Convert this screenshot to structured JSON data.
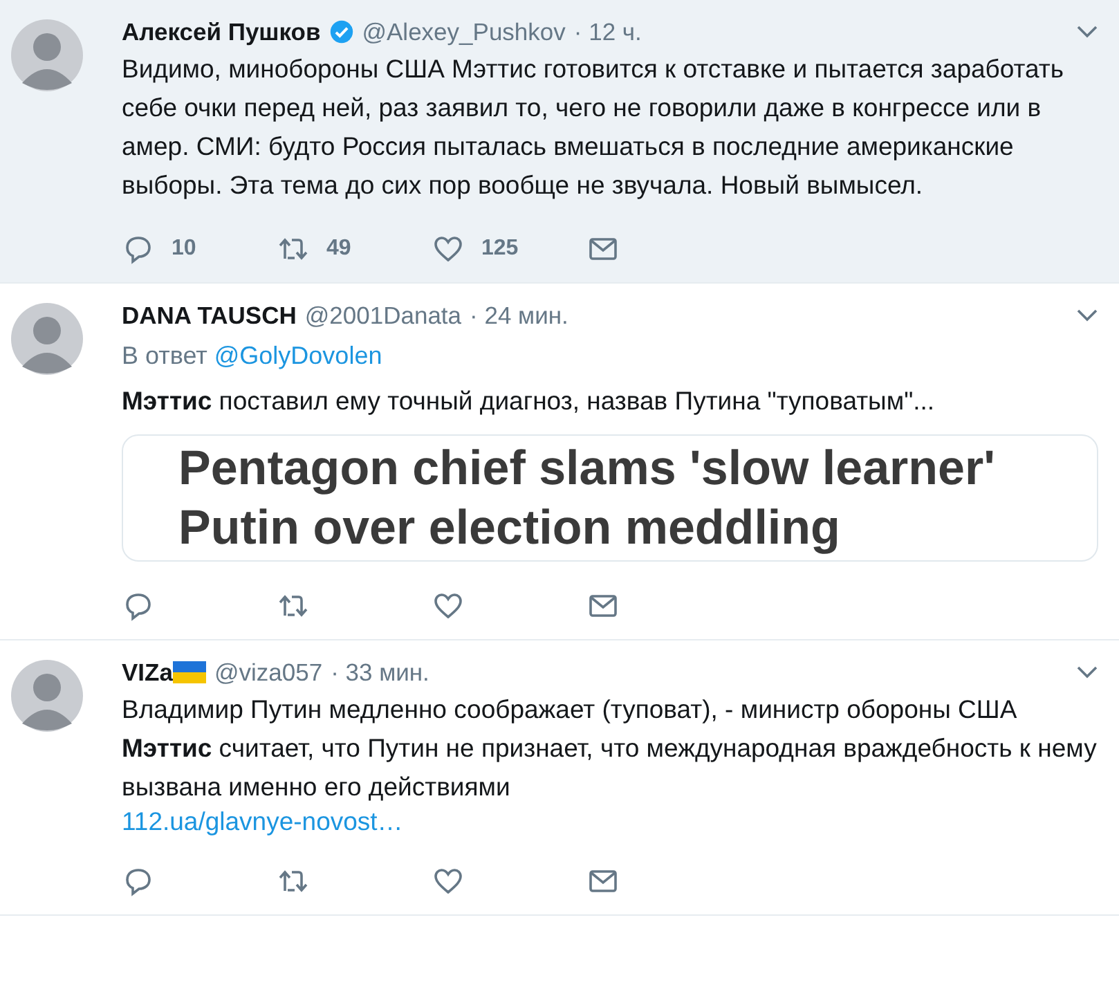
{
  "tweets": [
    {
      "highlighted": true,
      "name": "Алексей Пушков",
      "verified": true,
      "flag": false,
      "handle": "@Alexey_Pushkov",
      "time": "· 12 ч.",
      "text": "Видимо,  минобороны США Мэттис готовится к отставке и пытается заработать себе очки перед ней, раз заявил то, чего не говорили даже в конгрессе или в амер. СМИ: будто Россия пыталась вмешаться в последние американские выборы. Эта тема до сих пор вообще не звучала. Новый вымысел.",
      "actions": {
        "replies": "10",
        "retweets": "49",
        "likes": "125"
      }
    },
    {
      "highlighted": false,
      "name": "DANA TAUSCH",
      "verified": false,
      "flag": false,
      "handle": "@2001Danata",
      "time": "· 24 мин.",
      "reply_label": "В ответ",
      "reply_to": "@GolyDovolen",
      "text": "**Мэттис** поставил ему точный диагноз, назвав Путина \"туповатым\"...",
      "card": "Pentagon chief slams 'slow learner' Putin over election meddling"
    },
    {
      "highlighted": false,
      "name": "VIZa",
      "verified": false,
      "flag": true,
      "handle": "@viza057",
      "time": "· 33 мин.",
      "text": "Владимир Путин медленно соображает (туповат), - министр обороны США **Мэттис** считает, что Путин не признает, что международная враждебность к нему вызвана именно его действиями",
      "link": "112.ua/glavnye-novost…"
    }
  ]
}
